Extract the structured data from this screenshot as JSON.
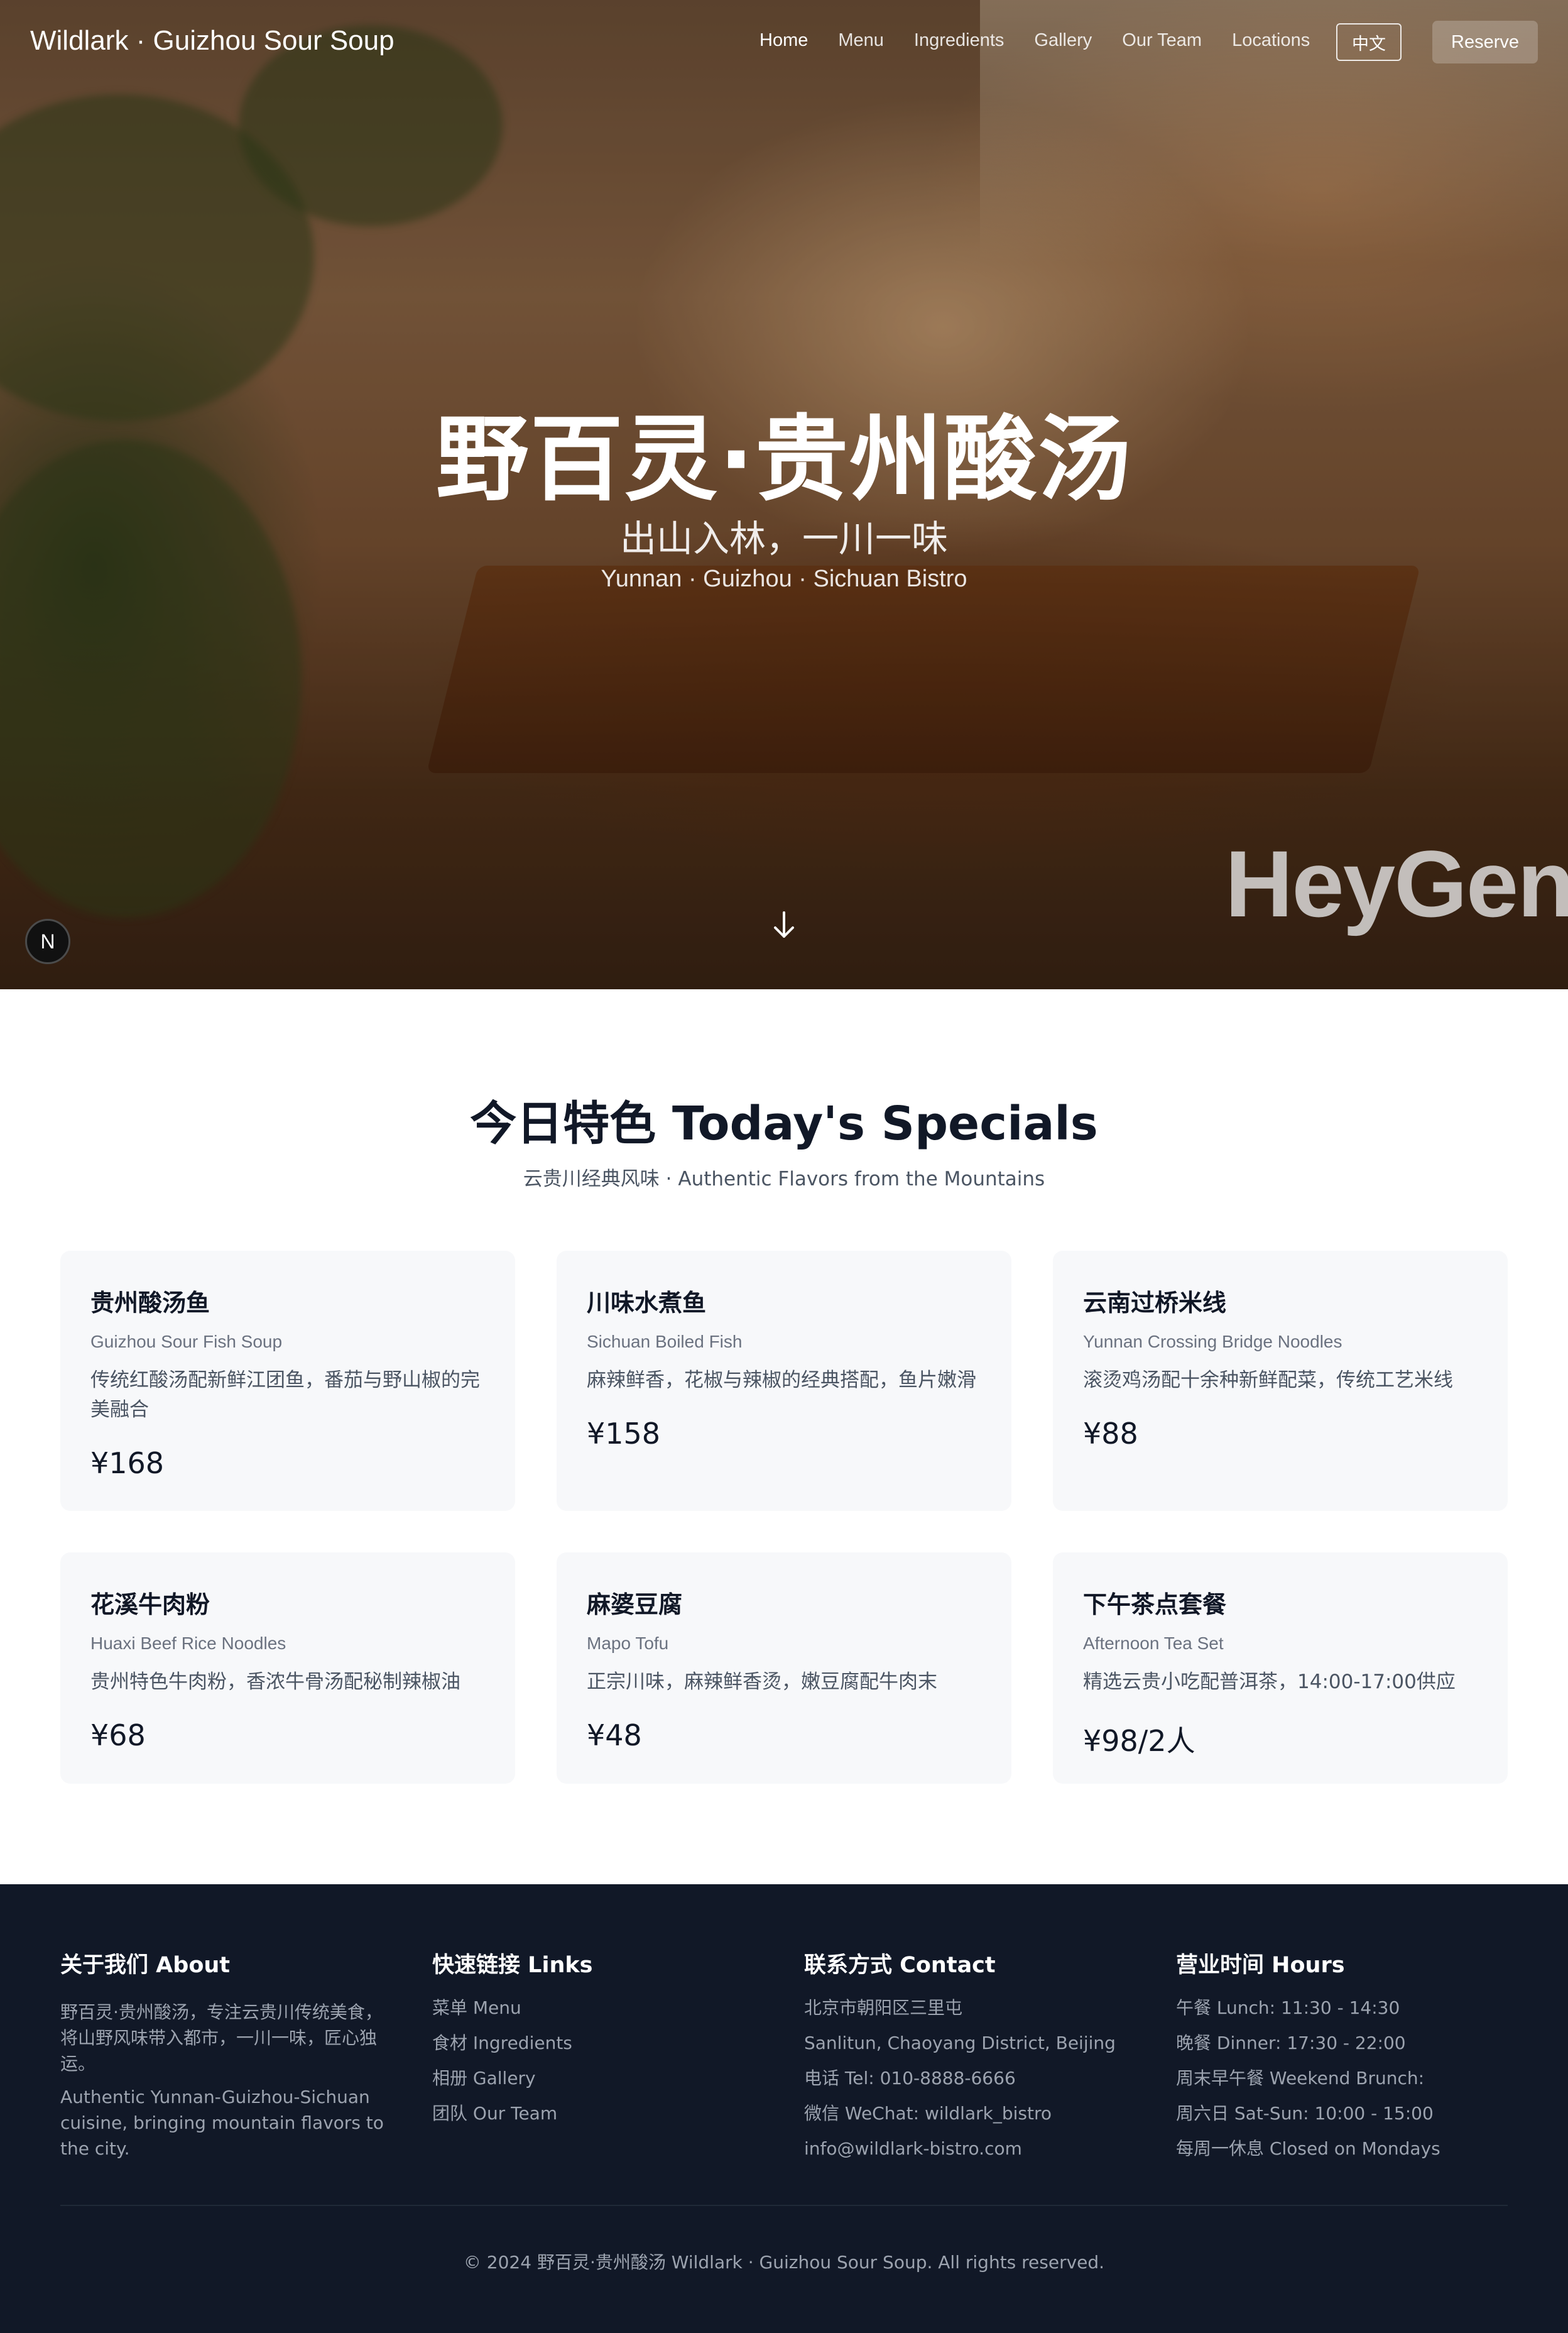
{
  "nav": {
    "brand": "Wildlark · Guizhou Sour Soup",
    "links": [
      "Home",
      "Menu",
      "Ingredients",
      "Gallery",
      "Our Team",
      "Locations"
    ],
    "active_link": "Home",
    "language_button": "中文",
    "reserve_button": "Reserve"
  },
  "hero": {
    "title": "野百灵·贵州酸汤",
    "subtitle": "出山入林，一川一味",
    "subtitle_en": "Yunnan · Guizhou · Sichuan Bistro",
    "watermark": "HeyGen",
    "badge": "N",
    "scroll_icon": "arrow-down-icon"
  },
  "specials": {
    "title": "今日特色 Today's Specials",
    "subtitle": "云贵川经典风味 · Authentic Flavors from the Mountains",
    "items": [
      {
        "name": "贵州酸汤鱼",
        "name_en": "Guizhou Sour Fish Soup",
        "desc": "传统红酸汤配新鲜江团鱼，番茄与野山椒的完美融合",
        "price": "¥168"
      },
      {
        "name": "川味水煮鱼",
        "name_en": "Sichuan Boiled Fish",
        "desc": "麻辣鲜香，花椒与辣椒的经典搭配，鱼片嫩滑",
        "price": "¥158"
      },
      {
        "name": "云南过桥米线",
        "name_en": "Yunnan Crossing Bridge Noodles",
        "desc": "滚烫鸡汤配十余种新鲜配菜，传统工艺米线",
        "price": "¥88"
      },
      {
        "name": "花溪牛肉粉",
        "name_en": "Huaxi Beef Rice Noodles",
        "desc": "贵州特色牛肉粉，香浓牛骨汤配秘制辣椒油",
        "price": "¥68"
      },
      {
        "name": "麻婆豆腐",
        "name_en": "Mapo Tofu",
        "desc": "正宗川味，麻辣鲜香烫，嫩豆腐配牛肉末",
        "price": "¥48"
      },
      {
        "name": "下午茶点套餐",
        "name_en": "Afternoon Tea Set",
        "desc": "精选云贵小吃配普洱茶，14:00-17:00供应",
        "price": "¥98/2人"
      }
    ]
  },
  "footer": {
    "about": {
      "heading": "关于我们 About",
      "text_zh": "野百灵·贵州酸汤，专注云贵川传统美食，将山野风味带入都市，一川一味，匠心独运。",
      "text_en": "Authentic Yunnan-Guizhou-Sichuan cuisine, bringing mountain flavors to the city."
    },
    "links": {
      "heading": "快速链接 Links",
      "items": [
        "菜单 Menu",
        "食材 Ingredients",
        "相册 Gallery",
        "团队 Our Team"
      ]
    },
    "contact": {
      "heading": "联系方式 Contact",
      "lines": [
        "北京市朝阳区三里屯",
        "Sanlitun, Chaoyang District, Beijing",
        "电话 Tel: 010-8888-6666",
        "微信 WeChat: wildlark_bistro",
        "info@wildlark-bistro.com"
      ]
    },
    "hours": {
      "heading": "营业时间 Hours",
      "lines": [
        "午餐 Lunch: 11:30 - 14:30",
        "晚餐 Dinner: 17:30 - 22:00",
        "周末早午餐 Weekend Brunch:",
        "周六日 Sat-Sun: 10:00 - 15:00",
        "每周一休息 Closed on Mondays"
      ]
    },
    "copyright": "© 2024 野百灵·贵州酸汤 Wildlark · Guizhou Sour Soup. All rights reserved."
  },
  "colors": {
    "footer_bg": "#111827",
    "card_bg": "#f7f8fa",
    "text_dark": "#111827",
    "text_muted": "#6b7280"
  }
}
